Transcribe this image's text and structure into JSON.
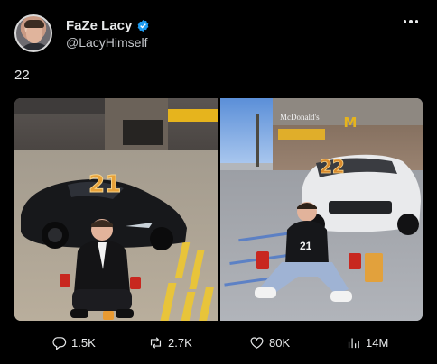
{
  "author": {
    "display_name": "FaZe Lacy",
    "handle": "@LacyHimself",
    "verified": true,
    "accent": "#1d9bf0"
  },
  "tweet": {
    "text": "22"
  },
  "media": {
    "left": {
      "cake_numbers": "21"
    },
    "right": {
      "cake_numbers": "22",
      "shirt_number": "21",
      "sign": "McDonald's"
    }
  },
  "actions": {
    "replies": "1.5K",
    "reposts": "2.7K",
    "likes": "80K",
    "views": "14M"
  },
  "icons": [
    "more-icon",
    "verified-icon",
    "reply-icon",
    "repost-icon",
    "like-icon",
    "views-icon"
  ]
}
